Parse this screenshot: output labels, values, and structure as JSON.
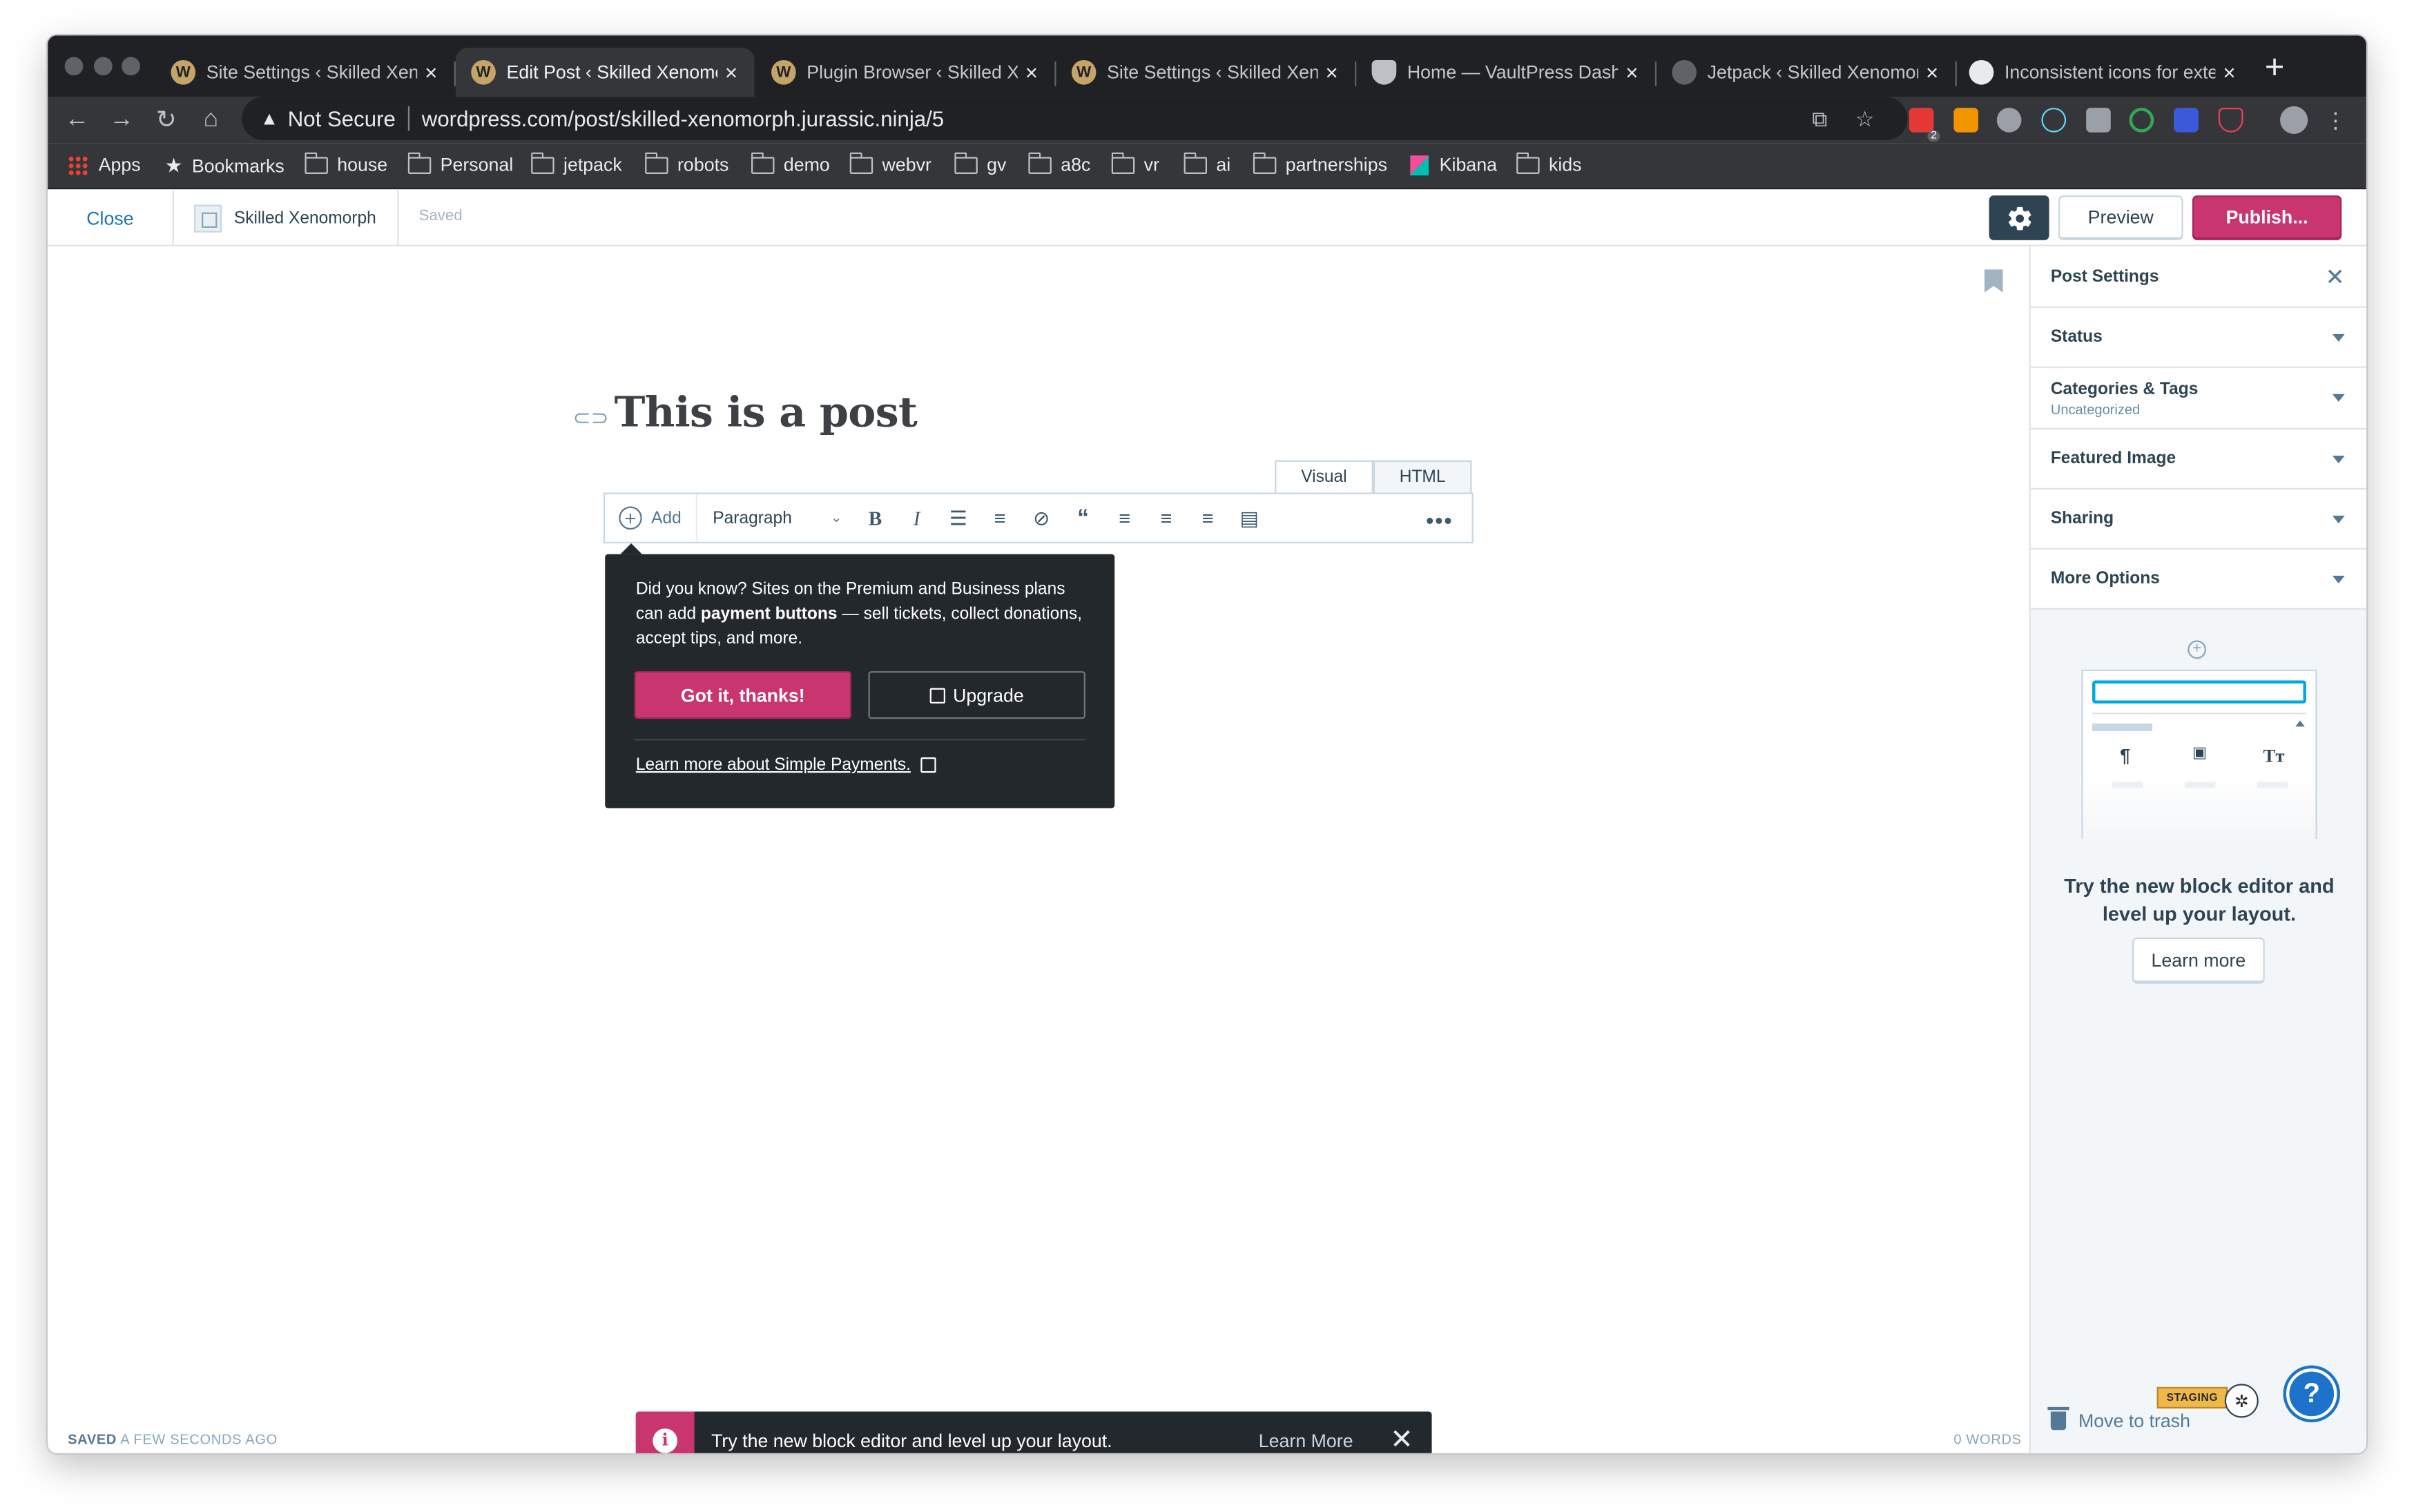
{
  "browser": {
    "tabs": [
      {
        "title": "Site Settings ‹ Skilled Xeno",
        "icon": "wordpress-icon",
        "active": false
      },
      {
        "title": "Edit Post ‹ Skilled Xenomo",
        "icon": "wordpress-icon",
        "active": true
      },
      {
        "title": "Plugin Browser ‹ Skilled Xe",
        "icon": "wordpress-icon",
        "active": false
      },
      {
        "title": "Site Settings ‹ Skilled Xen",
        "icon": "wordpress-icon",
        "active": false
      },
      {
        "title": "Home — VaultPress Dashb",
        "icon": "shield-icon",
        "active": false
      },
      {
        "title": "Jetpack ‹ Skilled Xenomor",
        "icon": "jetpack-icon",
        "active": false
      },
      {
        "title": "Inconsistent icons for exte",
        "icon": "github-icon",
        "active": false
      }
    ],
    "security_label": "Not Secure",
    "url": "wordpress.com/post/skilled-xenomorph.jurassic.ninja/5",
    "bookmarks": [
      "Apps",
      "Bookmarks",
      "house",
      "Personal",
      "jetpack",
      "robots",
      "demo",
      "webvr",
      "gv",
      "a8c",
      "vr",
      "ai",
      "partnerships",
      "Kibana",
      "kids"
    ],
    "extension_badge": "2"
  },
  "masterbar": {
    "close": "Close",
    "site_name": "Skilled Xenomorph",
    "save_status": "Saved",
    "preview": "Preview",
    "publish": "Publish..."
  },
  "editor": {
    "title": "This is a post",
    "mode_tabs": [
      "Visual",
      "HTML"
    ],
    "toolbar": {
      "add": "Add",
      "format": "Paragraph"
    },
    "popover": {
      "text_before": "Did you know? Sites on the Premium and Business plans can add ",
      "text_bold": "payment buttons",
      "text_after": " — sell tickets, collect donations, accept tips, and more.",
      "got_it": "Got it, thanks!",
      "upgrade": "Upgrade",
      "learn_more": "Learn more about Simple Payments."
    },
    "footer": {
      "saved_bold": "SAVED",
      "saved_rest": " A FEW SECONDS AGO",
      "words": "0 WORDS"
    },
    "notice": {
      "text": "Try the new block editor and level up your layout.",
      "action": "Learn More"
    }
  },
  "sidebar": {
    "title": "Post Settings",
    "sections": [
      {
        "label": "Status",
        "sub": ""
      },
      {
        "label": "Categories & Tags",
        "sub": "Uncategorized"
      },
      {
        "label": "Featured Image",
        "sub": ""
      },
      {
        "label": "Sharing",
        "sub": ""
      },
      {
        "label": "More Options",
        "sub": ""
      }
    ],
    "promo": {
      "title": "Try the new block editor and level up your layout.",
      "button": "Learn more"
    },
    "trash": "Move to trash",
    "staging": "STAGING"
  },
  "colors": {
    "accent": "#c9356e",
    "link": "#2271b1",
    "help": "#1d73c9"
  }
}
